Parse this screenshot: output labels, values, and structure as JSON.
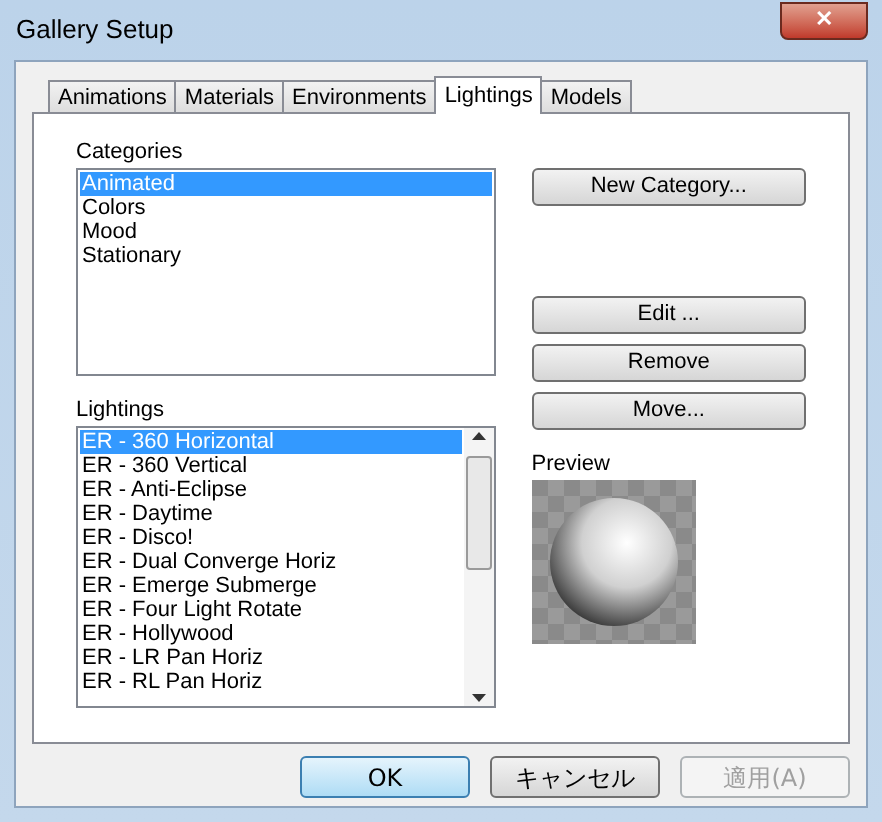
{
  "window": {
    "title": "Gallery Setup",
    "close": "✕"
  },
  "tabs": [
    {
      "label": "Animations",
      "selected": false
    },
    {
      "label": "Materials",
      "selected": false
    },
    {
      "label": "Environments",
      "selected": false
    },
    {
      "label": "Lightings",
      "selected": true
    },
    {
      "label": "Models",
      "selected": false
    }
  ],
  "categories": {
    "label": "Categories",
    "items": [
      {
        "label": "Animated",
        "selected": true
      },
      {
        "label": "Colors",
        "selected": false
      },
      {
        "label": "Mood",
        "selected": false
      },
      {
        "label": "Stationary",
        "selected": false
      }
    ]
  },
  "side_buttons": {
    "new_category": "New Category...",
    "edit": "Edit ...",
    "remove": "Remove",
    "move": "Move..."
  },
  "lightings": {
    "label": "Lightings",
    "items": [
      {
        "label": "ER - 360 Horizontal",
        "selected": true
      },
      {
        "label": "ER - 360 Vertical",
        "selected": false
      },
      {
        "label": "ER - Anti-Eclipse",
        "selected": false
      },
      {
        "label": "ER - Daytime",
        "selected": false
      },
      {
        "label": "ER - Disco!",
        "selected": false
      },
      {
        "label": "ER - Dual Converge Horiz",
        "selected": false
      },
      {
        "label": "ER - Emerge Submerge",
        "selected": false
      },
      {
        "label": "ER - Four Light Rotate",
        "selected": false
      },
      {
        "label": "ER - Hollywood",
        "selected": false
      },
      {
        "label": "ER - LR Pan Horiz",
        "selected": false
      },
      {
        "label": "ER - RL Pan Horiz",
        "selected": false
      }
    ]
  },
  "preview": {
    "label": "Preview"
  },
  "buttons": [
    {
      "label": "OK",
      "disabled": false,
      "default": true
    },
    {
      "label": "キャンセル",
      "disabled": false,
      "default": false
    },
    {
      "label": "適用(A)",
      "disabled": true,
      "default": false
    }
  ]
}
